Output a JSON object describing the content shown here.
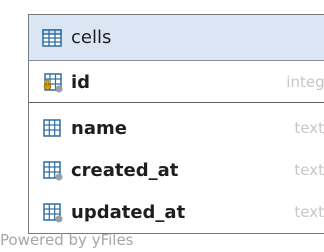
{
  "table": {
    "name": "cells",
    "icon": "table-icon",
    "primary_key": {
      "name": "id",
      "type": "integer",
      "icon": "primary-key-column-icon"
    },
    "columns": [
      {
        "name": "name",
        "type": "text",
        "icon": "column-icon"
      },
      {
        "name": "created_at",
        "type": "text",
        "icon": "column-icon"
      },
      {
        "name": "updated_at",
        "type": "text",
        "icon": "column-icon"
      }
    ]
  },
  "footer": {
    "watermark": "Powered by yFiles"
  },
  "colors": {
    "header_bg": "#dbe6f4",
    "border": "#777a82",
    "type_text": "#c7c7c7",
    "watermark": "#a6a6a6",
    "icon_blue": "#2e6da4",
    "key_gold": "#e0a400"
  }
}
